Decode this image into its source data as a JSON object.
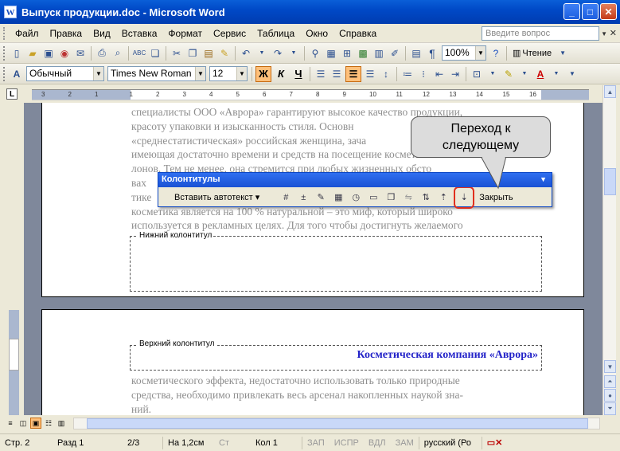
{
  "window": {
    "title": "Выпуск продукции.doc - Microsoft Word",
    "app_icon_letter": "W"
  },
  "menu": {
    "items": [
      "Файл",
      "Правка",
      "Вид",
      "Вставка",
      "Формат",
      "Сервис",
      "Таблица",
      "Окно",
      "Справка"
    ],
    "help_placeholder": "Введите вопрос"
  },
  "standard_toolbar": {
    "zoom": "100%",
    "read_label": "Чтение"
  },
  "formatting_toolbar": {
    "style": "Обычный",
    "font": "Times New Roman",
    "size": "12",
    "bold": "Ж",
    "italic": "К",
    "underline": "Ч"
  },
  "ruler": {
    "ticks": [
      "3",
      "2",
      "1",
      "1",
      "2",
      "3",
      "4",
      "5",
      "6",
      "7",
      "8",
      "9",
      "10",
      "11",
      "12",
      "13",
      "14",
      "15",
      "16"
    ]
  },
  "document": {
    "page1_lines": [
      "специалисты ООО «Аврора» гарантируют высокое качество продукции,",
      "красоту упаковки и изысканность стиля. Основн",
      "«среднестатистическая» российская женщина, зача",
      "имеющая достаточно времени и средств на посещение косметиче",
      "лонов. Тем не менее, она стремится при любых жизненных обсто",
      "вах",
      "тике",
      "косметика является на 100 % натуральной – это миф, который широко",
      "используется в рекламных целях. Для того чтобы достигнуть желаемого"
    ],
    "footer_label": "Нижний колонтитул",
    "header_label": "Верхний колонтитул",
    "header_text": "Косметическая компания «Аврора»",
    "page2_lines": [
      "косметического эффекта, недостаточно использовать только природные",
      "средства, необходимо привлекать весь арсенал накопленных наукой зна-",
      "ний."
    ]
  },
  "hf_toolbar": {
    "title": "Колонтитулы",
    "insert_autotext": "Вставить автотекст",
    "close_label": "Закрыть"
  },
  "callout": {
    "text_line1": "Переход к",
    "text_line2": "следующему"
  },
  "status": {
    "page": "Стр. 2",
    "section": "Разд 1",
    "pages": "2/3",
    "at": "На 1,2см",
    "line": "Ст",
    "col": "Кол 1",
    "rec": "ЗАП",
    "trk": "ИСПР",
    "ext": "ВДЛ",
    "ovr": "ЗАМ",
    "lang": "русский (Ро"
  }
}
